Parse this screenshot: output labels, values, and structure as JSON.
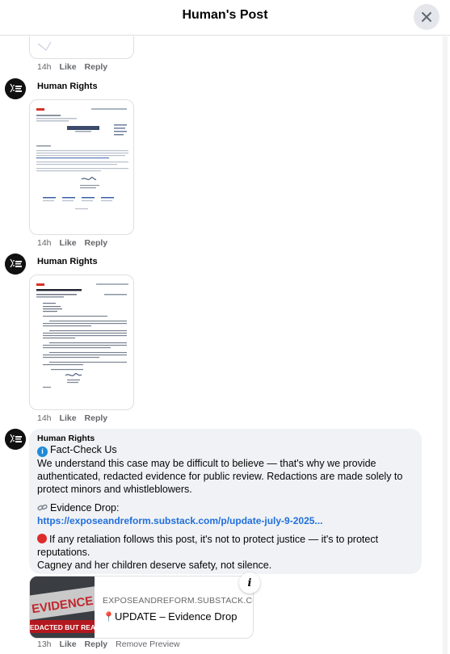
{
  "header": {
    "title": "Human's Post",
    "close_icon": "close-icon"
  },
  "comments": [
    {
      "time": "14h",
      "like_label": "Like",
      "reply_label": "Reply"
    },
    {
      "author": "Human Rights",
      "time": "14h",
      "like_label": "Like",
      "reply_label": "Reply"
    },
    {
      "author": "Human Rights",
      "time": "14h",
      "like_label": "Like",
      "reply_label": "Reply"
    },
    {
      "author": "Human Rights",
      "fact_check": "Fact-Check Us",
      "para1": "We understand this case may be difficult to believe — that's why we provide authenticated, redacted evidence for public review. Redactions are made solely to protect minors and whistleblowers.",
      "evidence_label": "Evidence Drop:",
      "link_text": "https://exposeandreform.substack.com/p/update-july-9-2025...",
      "warning": "If any retaliation follows this post, it's not to protect justice — it's to protect reputations.",
      "closing": "Cagney and her children deserve safety, not silence.",
      "preview": {
        "domain": "EXPOSEANDREFORM.SUBSTACK.COM",
        "title": "UPDATE – Evidence Drop",
        "image_text_top": "EVIDENCE",
        "image_text_bottom": "REDACTED BUT REAL"
      },
      "time": "13h",
      "like_label": "Like",
      "reply_label": "Reply",
      "remove_preview_label": "Remove Preview"
    }
  ],
  "icons": {
    "avatar": "avatar-icon",
    "info": "info-icon",
    "link": "link-icon",
    "pin": "pin-icon",
    "red_circle": "red-circle-icon"
  }
}
